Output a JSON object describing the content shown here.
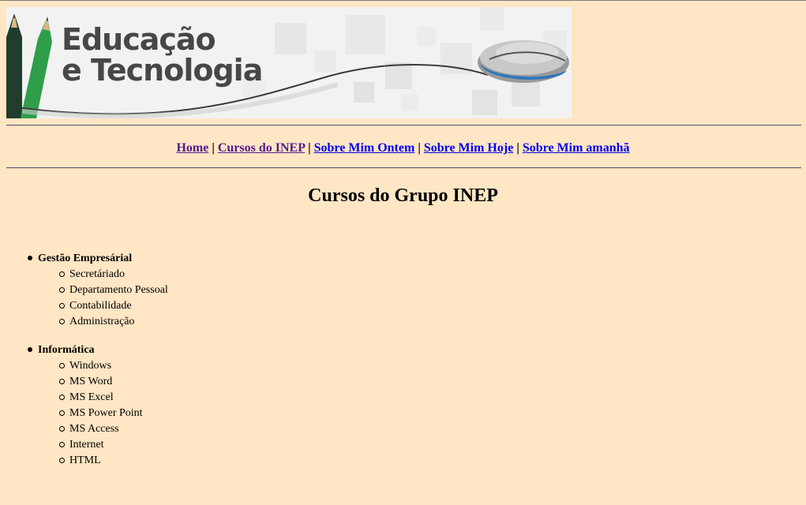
{
  "banner": {
    "title_line1": "Educação",
    "title_line2": "e Tecnologia",
    "pencil_color_dark": "#1f3d2c",
    "pencil_color_green": "#2f9e4a",
    "mouse_color": "#2e78b8",
    "text_color": "#474747"
  },
  "nav": {
    "items": [
      {
        "label": "Home",
        "visited": true
      },
      {
        "label": "Cursos do INEP",
        "visited": true
      },
      {
        "label": "Sobre Mim Ontem",
        "visited": false
      },
      {
        "label": "Sobre Mim Hoje",
        "visited": false
      },
      {
        "label": "Sobre Mim amanhã",
        "visited": false
      }
    ],
    "separator": "|",
    "visited_color": "#551a8b",
    "link_color": "#0000ee"
  },
  "page": {
    "title": "Cursos do Grupo INEP",
    "background": "#ffe6c4"
  },
  "courses": {
    "groups": [
      {
        "name": "Gestão Empresárial",
        "items": [
          "Secretáriado",
          "Departamento Pessoal",
          "Contabilidade",
          "Administração"
        ]
      },
      {
        "name": "Informática",
        "items": [
          "Windows",
          "MS Word",
          "MS Excel",
          "MS Power Point",
          "MS Access",
          "Internet",
          "HTML"
        ]
      }
    ]
  }
}
